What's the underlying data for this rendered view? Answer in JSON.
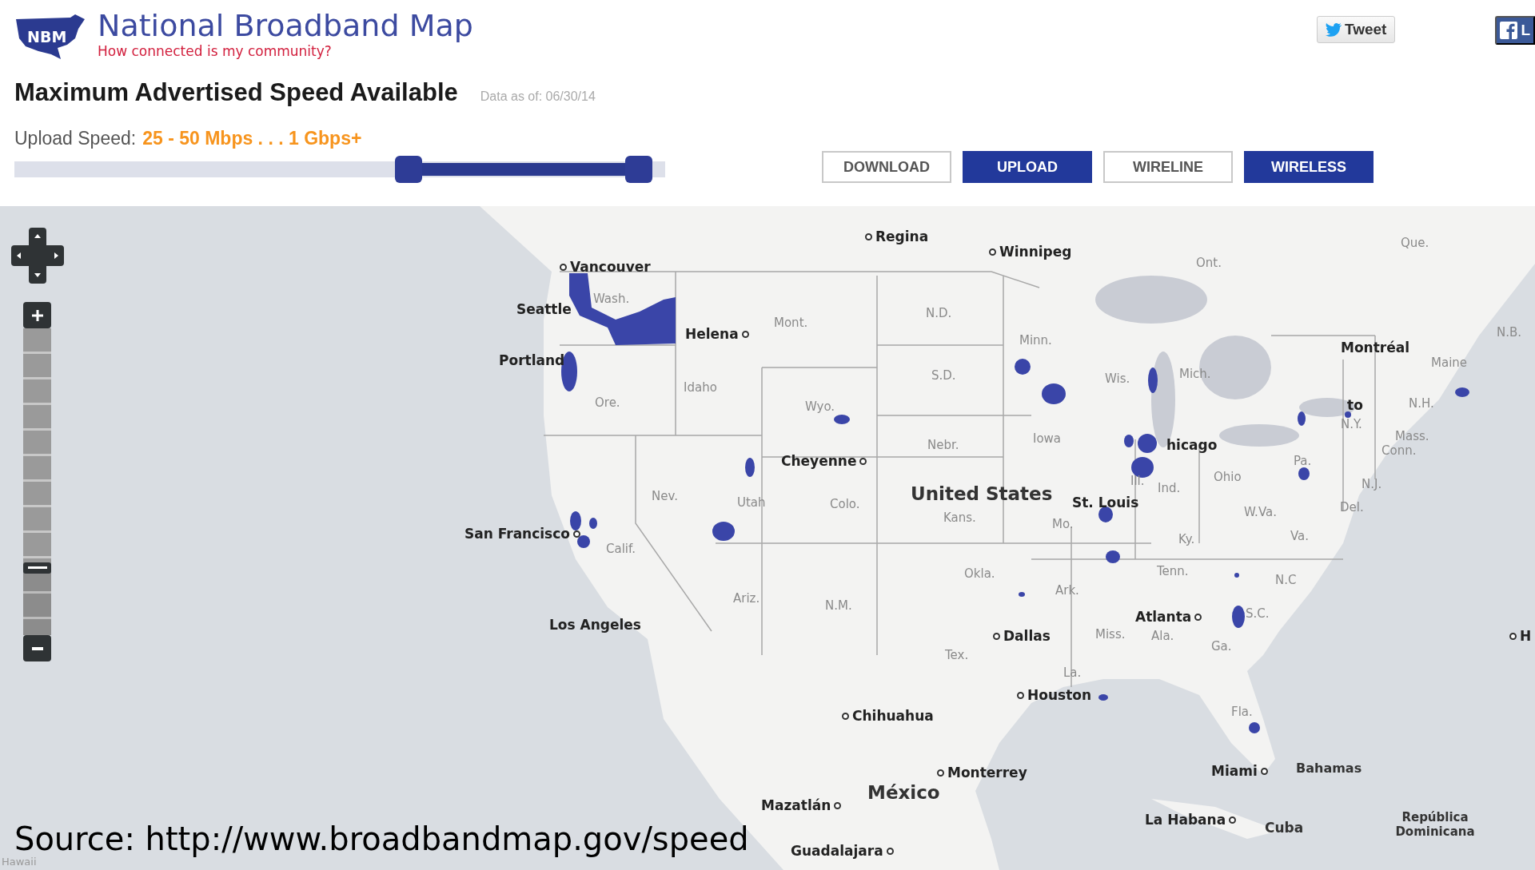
{
  "header": {
    "logo_text": "NBM",
    "title": "National Broadband Map",
    "subtitle": "How connected is my community?"
  },
  "social_buttons": [
    {
      "kind": "twitter",
      "label": "Tweet"
    },
    {
      "kind": "facebook",
      "label": "L"
    }
  ],
  "heading": {
    "title": "Maximum Advertised Speed Available",
    "data_date": "Data as of: 06/30/14"
  },
  "speed_filter": {
    "label": "Upload Speed:",
    "range": "25 - 50 Mbps . . . 1 Gbps+",
    "handles": [
      {
        "level": 0.61
      },
      {
        "level": 0.98
      }
    ]
  },
  "mode_buttons": [
    {
      "label": "DOWNLOAD",
      "selected": false
    },
    {
      "label": "UPLOAD",
      "selected": true
    },
    {
      "label": "WIRELINE",
      "selected": false
    },
    {
      "label": "WIRELESS",
      "selected": true
    }
  ],
  "map": {
    "zoom_control": {
      "level": 0.22
    },
    "countries": [
      "United States",
      "Bahamas",
      "México",
      "Cuba",
      "República Dominicana"
    ],
    "cities": [
      "Regina",
      "Winnipeg",
      "Vancouver",
      "Seattle",
      "Helena",
      "Montréal",
      "Portland",
      "to",
      "hicago",
      "Cheyenne",
      "St. Louis",
      "San Francisco",
      "Los Angeles",
      "Atlanta",
      "Dallas",
      "H",
      "Houston",
      "Chihuahua",
      "Monterrey",
      "Miami",
      "Mazatlán",
      "La Habana",
      "Guadalajara"
    ],
    "regions": [
      "Que.",
      "Ont.",
      "Wash.",
      "Mont.",
      "N.D.",
      "N.B.",
      "Minn.",
      "Maine",
      "S.D.",
      "Wis.",
      "Mich.",
      "Idaho",
      "Ore.",
      "Wyo.",
      "N.H.",
      "N.Y.",
      "Nebr.",
      "Iowa",
      "Mass.",
      "Conn.",
      "Pa.",
      "Ill.",
      "Ind.",
      "Ohio",
      "N.J.",
      "Nev.",
      "Utah",
      "Colo.",
      "Del.",
      "Kans.",
      "Mo.",
      "W.Va.",
      "Ky.",
      "Va.",
      "Calif.",
      "Okla.",
      "Tenn.",
      "N.C",
      "Ark.",
      "Ariz.",
      "N.M.",
      "S.C.",
      "Miss.",
      "Ala.",
      "Ga.",
      "Tex.",
      "La.",
      "Fla."
    ],
    "inset_label": "Hawaii"
  },
  "caption": "Source: http://www.broadbandmap.gov/speed"
}
